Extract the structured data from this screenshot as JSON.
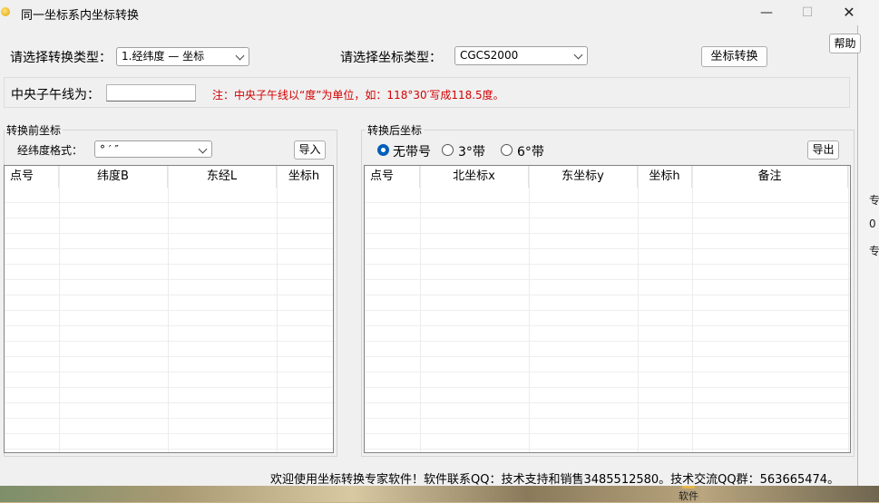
{
  "window": {
    "title": "同一坐标系内坐标转换"
  },
  "window_controls": {
    "minimize": "—",
    "maximize": "☐",
    "close": "✕"
  },
  "help_button": "帮助",
  "convert_type": {
    "label": "请选择转换类型：",
    "value": "1.经纬度 — 坐标"
  },
  "coord_type": {
    "label": "请选择坐标类型：",
    "value": "CGCS2000"
  },
  "convert_button": "坐标转换",
  "meridian": {
    "label": "中央子午线为：",
    "value": "",
    "note": "注：中央子午线以“度”为单位，如：118°30′写成118.5度。"
  },
  "before": {
    "title": "转换前坐标",
    "format_label": "经纬度格式：",
    "format_value": "° ′ ″",
    "import_button": "导入",
    "columns": [
      "点号",
      "纬度B",
      "东经L",
      "坐标h"
    ]
  },
  "after": {
    "title": "转换后坐标",
    "radios": [
      {
        "label": "无带号",
        "checked": true
      },
      {
        "label": "3°带",
        "checked": false
      },
      {
        "label": "6°带",
        "checked": false
      }
    ],
    "export_button": "导出",
    "columns": [
      "点号",
      "北坐标x",
      "东坐标y",
      "坐标h",
      "备注"
    ]
  },
  "footer": "欢迎使用坐标转换专家软件！软件联系QQ：技术支持和销售3485512580。技术交流QQ群：563665474。",
  "background": {
    "right_chars": [
      "专",
      "0",
      "专"
    ],
    "taskbar_item": "软件"
  },
  "icons": [
    "app-icon",
    "dropdown-arrow-icon",
    "radio-icon",
    "folder-icon"
  ]
}
